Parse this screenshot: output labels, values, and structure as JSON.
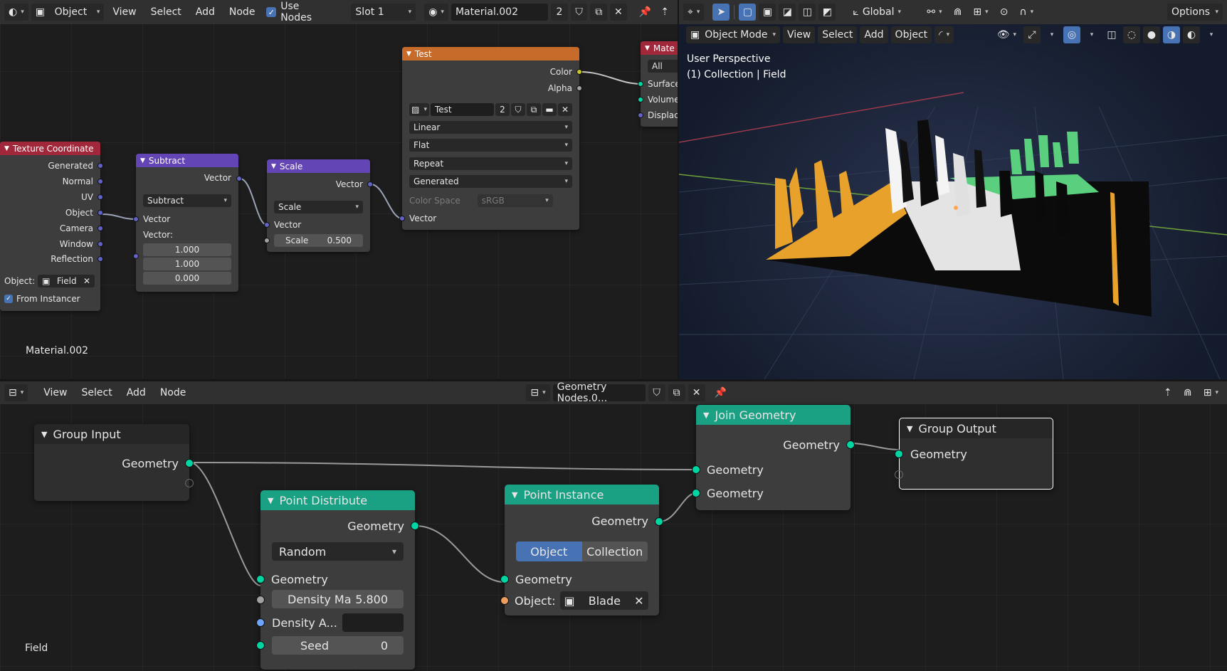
{
  "shader_editor": {
    "header": {
      "editor_type_icon": "node-editor-icon",
      "object_label": "Object",
      "menus": [
        "View",
        "Select",
        "Add",
        "Node"
      ],
      "use_nodes_label": "Use Nodes",
      "slot_label": "Slot 1",
      "material_name": "Material.002",
      "user_count": "2"
    },
    "material_label": "Material.002",
    "nodes": {
      "texture_coordinate": {
        "title": "Texture Coordinate",
        "outputs": [
          "Generated",
          "Normal",
          "UV",
          "Object",
          "Camera",
          "Window",
          "Reflection"
        ],
        "object_label": "Object:",
        "object_value": "Field",
        "from_instancer_label": "From Instancer"
      },
      "subtract": {
        "title": "Subtract",
        "output": "Vector",
        "operation": "Subtract",
        "input": "Vector",
        "vector_label": "Vector:",
        "values": [
          "1.000",
          "1.000",
          "0.000"
        ]
      },
      "scale": {
        "title": "Scale",
        "output": "Vector",
        "operation": "Scale",
        "input": "Vector",
        "scale_label": "Scale",
        "scale_value": "0.500"
      },
      "image_texture": {
        "title": "Test",
        "out_color": "Color",
        "out_alpha": "Alpha",
        "image_name": "Test",
        "image_users": "2",
        "interpolation": "Linear",
        "projection": "Flat",
        "extension": "Repeat",
        "source": "Generated",
        "color_space_label": "Color Space",
        "color_space_value": "sRGB",
        "input": "Vector"
      },
      "material_output": {
        "title": "Mate",
        "target": "All",
        "inputs": [
          "Surface",
          "Volume",
          "Displac"
        ]
      }
    }
  },
  "viewport": {
    "header": {
      "global_label": "Global",
      "options_label": "Options",
      "mode_label": "Object Mode",
      "menus": [
        "View",
        "Select",
        "Add",
        "Object"
      ]
    },
    "overlay_line1": "User Perspective",
    "overlay_line2": "(1) Collection | Field"
  },
  "geometry_editor": {
    "header": {
      "menus": [
        "View",
        "Select",
        "Add",
        "Node"
      ],
      "tree_name": "Geometry Nodes.0..."
    },
    "object_label": "Field",
    "nodes": {
      "group_input": {
        "title": "Group Input",
        "output": "Geometry"
      },
      "point_distribute": {
        "title": "Point Distribute",
        "output": "Geometry",
        "mode": "Random",
        "input_geometry": "Geometry",
        "density_max_label": "Density Ma",
        "density_max_value": "5.800",
        "density_attr_label": "Density A...",
        "seed_label": "Seed",
        "seed_value": "0"
      },
      "point_instance": {
        "title": "Point Instance",
        "output": "Geometry",
        "mode_object": "Object",
        "mode_collection": "Collection",
        "input_geometry": "Geometry",
        "object_label": "Object:",
        "object_value": "Blade"
      },
      "join_geometry": {
        "title": "Join Geometry",
        "output": "Geometry",
        "inputs": [
          "Geometry",
          "Geometry"
        ]
      },
      "group_output": {
        "title": "Group Output",
        "input": "Geometry"
      }
    }
  },
  "colors": {
    "texture_header": "#a1283a",
    "vector_header": "#6345b5",
    "image_header": "#c66b2a",
    "geo_header": "#1aa083",
    "output_header": "#1f1f1f",
    "selected_blue": "#4772b3"
  }
}
